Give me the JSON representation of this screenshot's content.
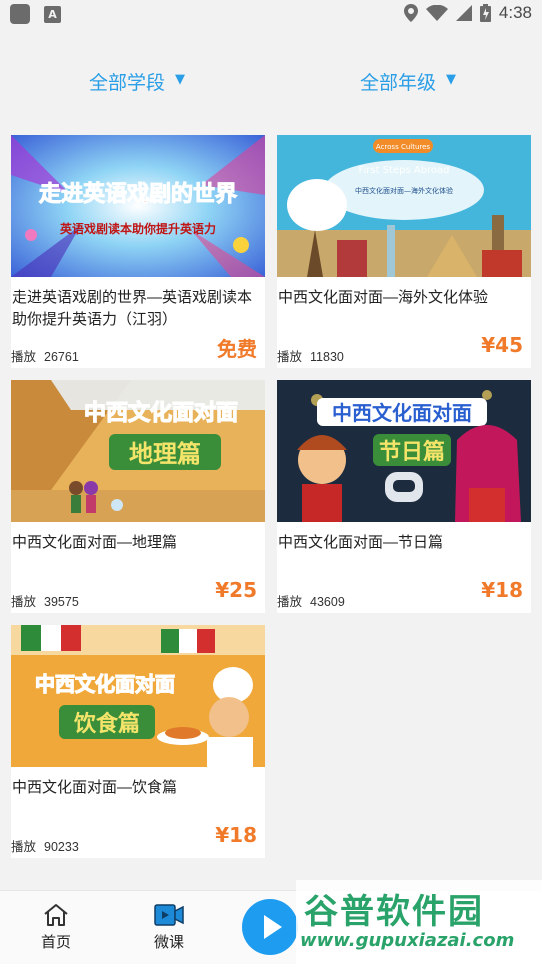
{
  "status_bar": {
    "time": "4:38"
  },
  "filters": {
    "stage": "全部学段",
    "grade": "全部年级"
  },
  "courses": [
    {
      "title": "走进英语戏剧的世界—英语戏剧读本助你提升英语力（江羽）",
      "plays_label": "播放",
      "plays": "26761",
      "price": "免费",
      "thumb_text": [
        "走进英语戏剧的世界",
        "英语戏剧读本助你提升英语力"
      ]
    },
    {
      "title": "中西文化面对面—海外文化体验",
      "plays_label": "播放",
      "plays": "11830",
      "price": "¥45",
      "thumb_text": [
        "Across Cultures",
        "First Steps Abroad",
        "中西文化面对面—海外文化体验"
      ]
    },
    {
      "title": "中西文化面对面—地理篇",
      "plays_label": "播放",
      "plays": "39575",
      "price": "¥25",
      "thumb_text": [
        "中西文化面对面",
        "地理篇"
      ]
    },
    {
      "title": "中西文化面对面—节日篇",
      "plays_label": "播放",
      "plays": "43609",
      "price": "¥18",
      "thumb_text": [
        "中西文化面对面",
        "节日篇"
      ]
    },
    {
      "title": "中西文化面对面—饮食篇",
      "plays_label": "播放",
      "plays": "90233",
      "price": "¥18",
      "thumb_text": [
        "中西文化面对面",
        "饮食篇"
      ]
    }
  ],
  "tabs": {
    "home": "首页",
    "micro": "微课"
  },
  "watermark": {
    "name": "谷普软件园",
    "url": "www.gupuxiazai.com"
  },
  "colors": {
    "accent": "#2a9ee6",
    "price": "#f07a2a",
    "play_button": "#1e9cf0",
    "watermark": "#2aa36a"
  }
}
